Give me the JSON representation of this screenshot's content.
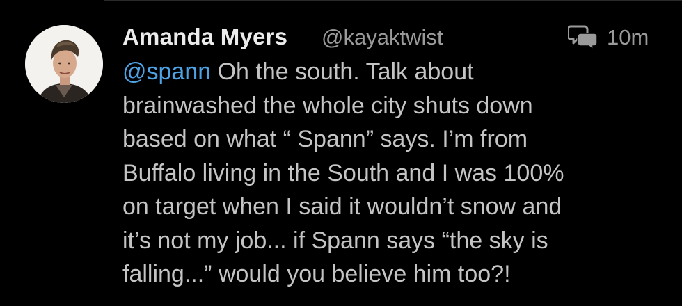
{
  "tweet": {
    "author_name": "Amanda Myers",
    "author_handle": "@kayaktwist",
    "timestamp": "10m",
    "mention": "@spann",
    "body": " Oh the south. Talk about\nbrainwashed the whole city shuts down\nbased on what “ Spann” says. I’m from\nBuffalo living in the South and I was 100%\non target when I said it wouldn’t snow and\nit’s not my job... if Spann says “the sky is\nfalling...” would you believe him too?!"
  },
  "icons": {
    "avatar": "avatar-photo",
    "reply": "conversation-icon"
  },
  "colors": {
    "background": "#000000",
    "name": "#ececec",
    "handle": "#9a9a9a",
    "body": "#c4c4c4",
    "mention": "#4ea3e5"
  }
}
